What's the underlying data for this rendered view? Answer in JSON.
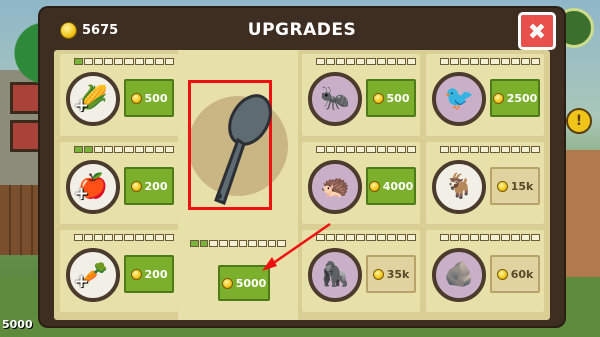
{
  "header": {
    "coins": "5675",
    "title": "UPGRADES",
    "close_glyph": "✖"
  },
  "background": {
    "bottom_text": "5000"
  },
  "cells": [
    {
      "bar": [
        1,
        0,
        0,
        0,
        0,
        0,
        0,
        0,
        0,
        0
      ],
      "icon": "🌽",
      "price": "500",
      "locked": false,
      "plus": true
    },
    {
      "bar": [
        1,
        1,
        0,
        0,
        0,
        0,
        0,
        0,
        0,
        0
      ],
      "icon": "🍎",
      "price": "200",
      "locked": false,
      "plus": true
    },
    {
      "bar": [
        0,
        0,
        0,
        0,
        0,
        0,
        0,
        0,
        0,
        0
      ],
      "icon": "🥕",
      "price": "200",
      "locked": false,
      "plus": true
    },
    {
      "bar": [
        0,
        0,
        0,
        0,
        0,
        0,
        0,
        0,
        0,
        0
      ],
      "icon": "🐜",
      "price": "500",
      "locked": false,
      "plus": false
    },
    {
      "bar": [
        0,
        0,
        0,
        0,
        0,
        0,
        0,
        0,
        0,
        0
      ],
      "icon": "🦔",
      "price": "4000",
      "locked": false,
      "plus": false
    },
    {
      "bar": [
        0,
        0,
        0,
        0,
        0,
        0,
        0,
        0,
        0,
        0
      ],
      "icon": "🦍",
      "price": "35k",
      "locked": true,
      "plus": false
    },
    {
      "bar": [
        0,
        0,
        0,
        0,
        0,
        0,
        0,
        0,
        0,
        0
      ],
      "icon": "🐦",
      "price": "2500",
      "locked": false,
      "plus": false
    },
    {
      "bar": [
        0,
        0,
        0,
        0,
        0,
        0,
        0,
        0,
        0,
        0
      ],
      "icon": "🐐",
      "price": "15k",
      "locked": true,
      "plus": false
    },
    {
      "bar": [
        0,
        0,
        0,
        0,
        0,
        0,
        0,
        0,
        0,
        0
      ],
      "icon": "🪨",
      "price": "60k",
      "locked": true,
      "plus": false
    }
  ],
  "featured": {
    "bar": [
      1,
      1,
      0,
      0,
      0,
      0,
      0,
      0,
      0,
      0
    ],
    "price": "5000",
    "icon": "ladle-icon"
  },
  "colors": {
    "highlight": "#ee1111",
    "buy": "#7cb02c",
    "panel": "#3e2e22"
  }
}
